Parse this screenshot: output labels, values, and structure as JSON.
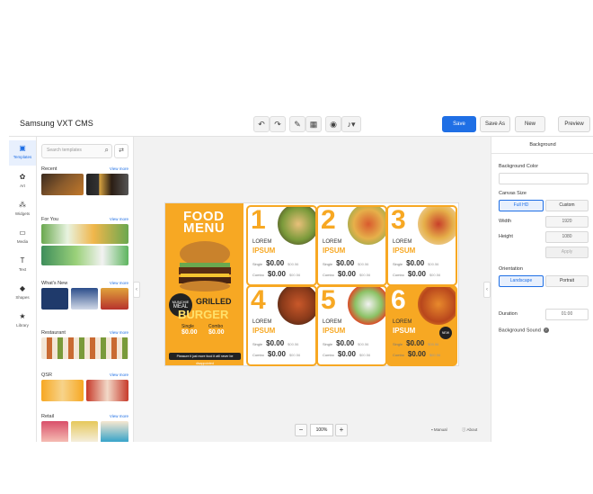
{
  "app": {
    "title": "Samsung VXT CMS"
  },
  "toolbar": {
    "undo_icon": "undo-icon",
    "redo_icon": "redo-icon",
    "save": "Save",
    "save_as": "Save As",
    "new": "New",
    "preview": "Preview"
  },
  "rail": {
    "items": [
      {
        "label": "Templates",
        "icon": "templates-icon"
      },
      {
        "label": "Art",
        "icon": "art-icon"
      },
      {
        "label": "Widgets",
        "icon": "widgets-icon"
      },
      {
        "label": "Media",
        "icon": "media-icon"
      },
      {
        "label": "Text",
        "icon": "text-icon"
      },
      {
        "label": "Shapes",
        "icon": "shapes-icon"
      },
      {
        "label": "Library",
        "icon": "library-icon"
      }
    ]
  },
  "templates": {
    "search_placeholder": "Search templates",
    "see_more": "View more",
    "sections": [
      {
        "title": "Recent"
      },
      {
        "title": "For You"
      },
      {
        "title": "What's New"
      },
      {
        "title": "Restaurant"
      },
      {
        "title": "QSR"
      },
      {
        "title": "Retail"
      }
    ]
  },
  "poster": {
    "headline_1": "FOOD",
    "headline_2": "MENU",
    "badge_1": "MUNCHIE",
    "badge_2": "MEAL",
    "grilled": "GRILLED",
    "burger": "BURGER",
    "price_a_label": "Single",
    "price_a": "$0.00",
    "price_b_label": "Combo",
    "price_b": "$0.00",
    "footer": "Pleasure it just more food it will never be disappointed",
    "items": [
      {
        "num": "1",
        "t1": "LOREM",
        "t2": "IPSUM",
        "single": "Single",
        "combo": "Combo",
        "p": "$0.00",
        "was": "$00.56"
      },
      {
        "num": "2",
        "t1": "LOREM",
        "t2": "IPSUM",
        "single": "Single",
        "combo": "Combo",
        "p": "$0.00",
        "was": "$00.56"
      },
      {
        "num": "3",
        "t1": "LOREM",
        "t2": "IPSUM",
        "single": "Single",
        "combo": "Combo",
        "p": "$0.00",
        "was": "$00.56"
      },
      {
        "num": "4",
        "t1": "LOREM",
        "t2": "IPSUM",
        "single": "Single",
        "combo": "Combo",
        "p": "$0.00",
        "was": "$00.56"
      },
      {
        "num": "5",
        "t1": "LOREM",
        "t2": "IPSUM",
        "single": "Single",
        "combo": "Combo",
        "p": "$0.00",
        "was": "$00.56"
      },
      {
        "num": "6",
        "t1": "LOREM",
        "t2": "IPSUM",
        "single": "Single",
        "combo": "Combo",
        "p": "$0.00",
        "was": "$00.56"
      }
    ],
    "new_badge": "NEW"
  },
  "zoom": {
    "minus": "−",
    "value": "100%",
    "plus": "+"
  },
  "canvas_footer": {
    "manual": "Manual",
    "about": "About"
  },
  "properties": {
    "tab": "Background",
    "bg_color_label": "Background Color",
    "canvas_size_label": "Canvas Size",
    "size_full_hd": "Full HD",
    "size_custom": "Custom",
    "width_label": "Width",
    "width_value": "1920",
    "height_label": "Height",
    "height_value": "1080",
    "apply": "Apply",
    "orientation_label": "Orientation",
    "landscape": "Landscape",
    "portrait": "Portrait",
    "duration_label": "Duration",
    "duration_value": "01:00",
    "bg_sound_label": "Background Sound"
  },
  "colors": {
    "accent": "#1f6fe5",
    "poster_orange": "#f7a823"
  }
}
